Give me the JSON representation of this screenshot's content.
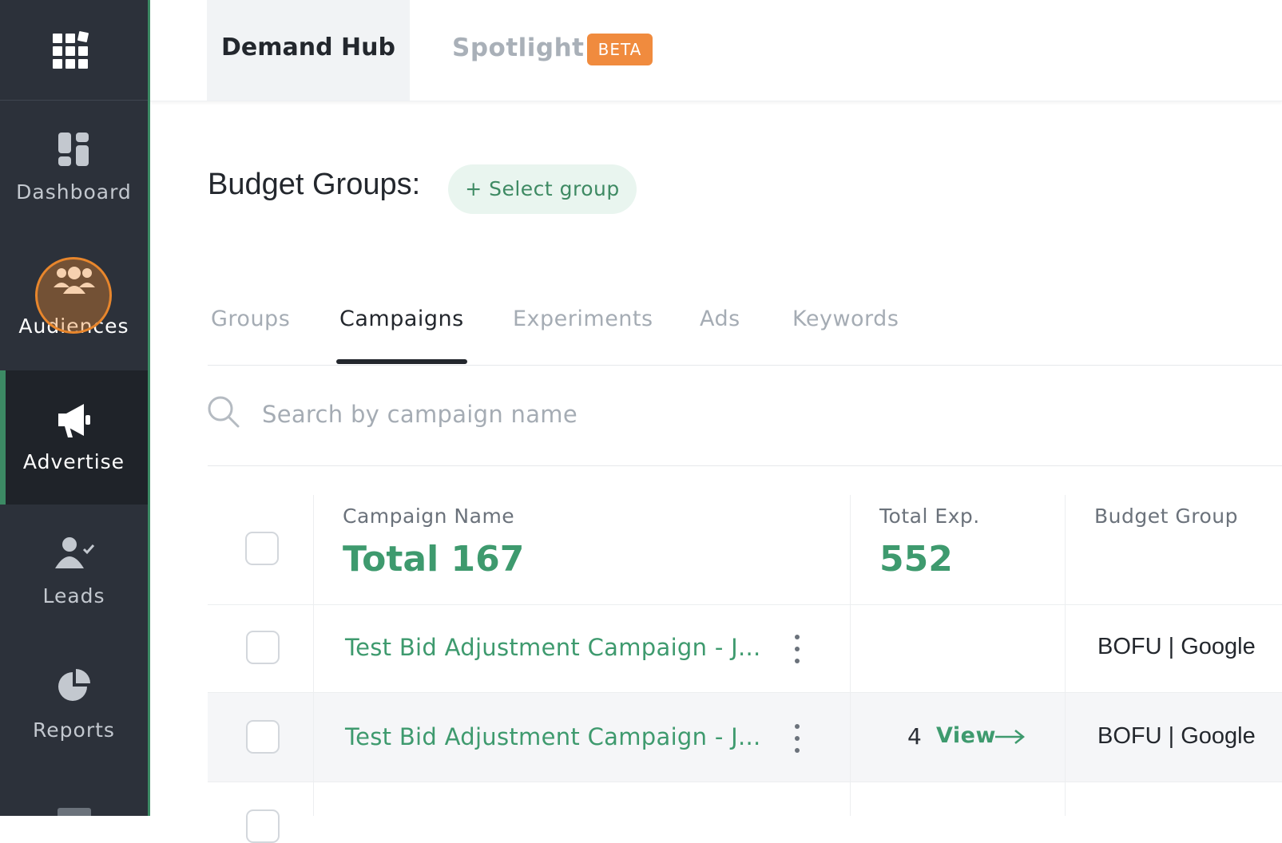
{
  "colors": {
    "accent": "#3e9a6e",
    "sidebar_bg": "#2c313a",
    "beta_bg": "#f08b3e",
    "highlight": "#e8862c"
  },
  "sidebar": {
    "items": [
      {
        "label": "Dashboard",
        "icon": "dashboard-icon"
      },
      {
        "label": "Audiences",
        "icon": "audiences-icon"
      },
      {
        "label": "Advertise",
        "icon": "megaphone-icon",
        "active": true
      },
      {
        "label": "Leads",
        "icon": "leads-icon"
      },
      {
        "label": "Reports",
        "icon": "pie-chart-icon"
      }
    ]
  },
  "header": {
    "tabs": [
      {
        "label": "Demand Hub",
        "active": true
      },
      {
        "label": "Spotlight",
        "badge": "BETA"
      }
    ]
  },
  "budget": {
    "title": "Budget Groups:",
    "select_label": "+ Select group"
  },
  "subtabs": [
    {
      "label": "Groups"
    },
    {
      "label": "Campaigns",
      "active": true
    },
    {
      "label": "Experiments"
    },
    {
      "label": "Ads"
    },
    {
      "label": "Keywords"
    }
  ],
  "search": {
    "placeholder": "Search by campaign name",
    "value": ""
  },
  "table": {
    "columns": [
      {
        "label": "Campaign Name",
        "total": "Total 167"
      },
      {
        "label": "Total Exp.",
        "total": "552"
      },
      {
        "label": "Budget Group"
      }
    ],
    "rows": [
      {
        "name": "Test Bid Adjustment Campaign - J...",
        "exp_count": "",
        "exp_link": "",
        "budget_group": "BOFU | Google"
      },
      {
        "name": "Test Bid Adjustment Campaign - J...",
        "exp_count": "4",
        "exp_link": "View",
        "budget_group": "BOFU | Google"
      }
    ]
  }
}
